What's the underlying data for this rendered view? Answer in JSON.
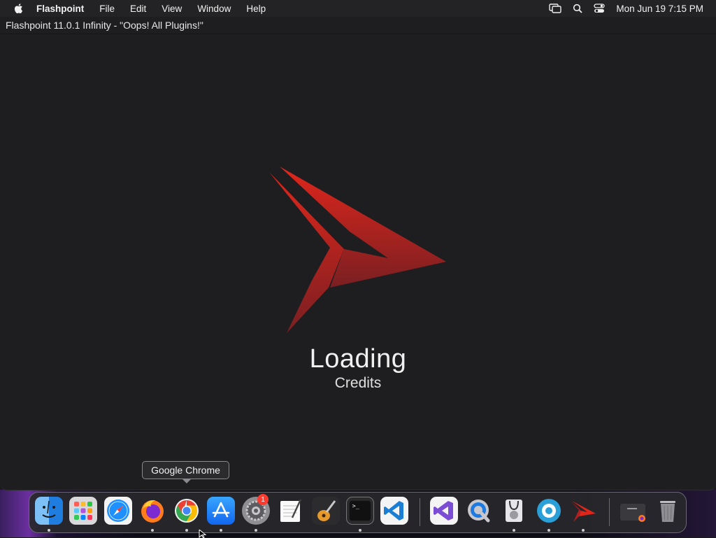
{
  "menubar": {
    "app_name": "Flashpoint",
    "items": [
      "File",
      "Edit",
      "View",
      "Window",
      "Help"
    ],
    "clock": "Mon Jun 19  7:15 PM",
    "icons": [
      "screen-mirroring-icon",
      "spotlight-search-icon",
      "control-center-icon"
    ]
  },
  "window": {
    "title": "Flashpoint 11.0.1 Infinity - \"Oops! All Plugins!\""
  },
  "loading": {
    "title": "Loading",
    "subtitle": "Credits"
  },
  "tooltip": {
    "text": "Google Chrome"
  },
  "dock": {
    "badge_count": "1",
    "apps": [
      {
        "name": "finder-icon",
        "running": true
      },
      {
        "name": "launchpad-icon",
        "running": false
      },
      {
        "name": "safari-icon",
        "running": false
      },
      {
        "name": "firefox-icon",
        "running": true
      },
      {
        "name": "google-chrome-icon",
        "running": true
      },
      {
        "name": "app-store-icon",
        "running": true
      },
      {
        "name": "system-preferences-icon",
        "running": true
      },
      {
        "name": "textedit-icon",
        "running": false
      },
      {
        "name": "garageband-icon",
        "running": false
      },
      {
        "name": "terminal-icon",
        "running": true
      },
      {
        "name": "vscode-icon",
        "running": false
      },
      {
        "name": "visual-studio-icon",
        "running": false
      },
      {
        "name": "quicktime-icon",
        "running": false
      },
      {
        "name": "disk-utility-icon",
        "running": true
      },
      {
        "name": "app-circle-icon",
        "running": true
      },
      {
        "name": "flashpoint-icon",
        "running": true
      },
      {
        "name": "downloads-stack-icon",
        "running": false
      },
      {
        "name": "trash-icon",
        "running": false
      }
    ]
  },
  "colors": {
    "logo_red": "#e0261b",
    "logo_dark_red": "#7a1a1a",
    "badge_red": "#ff3b30",
    "background": "#1e1e20"
  }
}
